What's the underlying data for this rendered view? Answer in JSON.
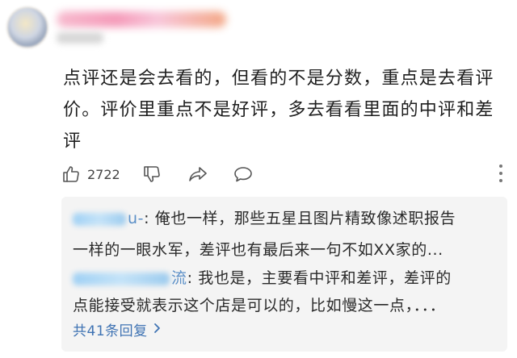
{
  "comment": {
    "text_lines": [
      "点评还是会去看的，但看的不是分数，重点是去看评",
      "价。评价里重点不是好评，多去看看里面的中评和差",
      "评"
    ]
  },
  "actions": {
    "like_count": "2722"
  },
  "replies": {
    "items": [
      {
        "user_suffix": "u-",
        "lines": [
          ": 俺也一样，那些五星且图片精致像述职报告",
          "一样的一眼水军，差评也有最后来一句不如XX家的..."
        ]
      },
      {
        "user_suffix": "流",
        "lines": [
          ": 我也是，主要看中评和差评，差评的",
          "点能接受就表示这个店是可以的，比如慢这一点，．．．"
        ]
      }
    ],
    "more_label": "共41条回复"
  },
  "colors": {
    "link": "#3f73b3",
    "reply_bg": "#f4f4f4",
    "text": "#1f1f1f"
  }
}
